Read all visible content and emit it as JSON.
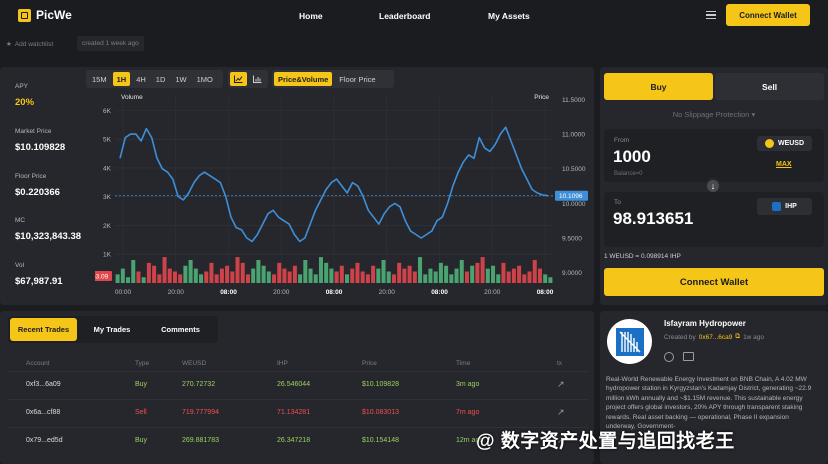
{
  "app": {
    "name": "PicWe"
  },
  "nav": {
    "links": [
      "Home",
      "Leaderboard",
      "My Assets"
    ],
    "connect_label": "Connect Wallet"
  },
  "subbar": {
    "watchlist": "Add watchlist",
    "created": "created 1 week ago"
  },
  "stats": [
    {
      "label": "APY",
      "value": "20%"
    },
    {
      "label": "Market Price",
      "value": "$10.109828"
    },
    {
      "label": "Floor Price",
      "value": "$0.220366"
    },
    {
      "label": "MC",
      "value": "$10,323,843.38"
    },
    {
      "label": "Vol",
      "value": "$67,987.91"
    }
  ],
  "chart_toolbar": {
    "intervals": [
      "15M",
      "1H",
      "4H",
      "1D",
      "1W",
      "1MO"
    ],
    "active_interval": "1H",
    "modes": [
      "Price&Volume",
      "Floor Price"
    ],
    "active_mode": "Price&Volume"
  },
  "chart_data": {
    "type": "line",
    "title": "",
    "left_axis_label": "Volume",
    "right_axis_label": "Price",
    "volume_ticks": [
      "6K",
      "5K",
      "4K",
      "3K",
      "2K",
      "1K"
    ],
    "price_ticks": [
      "11.5000",
      "11.0000",
      "10.5000",
      "10.0000",
      "9.5000",
      "9.0000"
    ],
    "x_ticks": [
      "00:00",
      "20:00",
      "08:00",
      "20:00",
      "08:00",
      "20:00",
      "08:00",
      "20:00",
      "08:00"
    ],
    "current_price_label": "10.1096",
    "current_volume_label": "53.09",
    "price": [
      10.65,
      10.95,
      11.0,
      11.0,
      10.9,
      11.08,
      10.95,
      10.65,
      10.5,
      10.45,
      10.35,
      10.1,
      10.05,
      10.15,
      10.3,
      10.4,
      10.45,
      10.4,
      10.35,
      10.3,
      10.1,
      9.8,
      9.65,
      9.62,
      9.5,
      9.45,
      9.55,
      9.7,
      9.85,
      9.9,
      9.8,
      9.75,
      9.7,
      9.55,
      9.45,
      9.5,
      9.7,
      9.9,
      10.05,
      10.2,
      10.3,
      10.35,
      10.25,
      10.15,
      10.3,
      10.25,
      10.1,
      9.9,
      9.8,
      9.7,
      9.85,
      9.95,
      10.0,
      9.95,
      9.75,
      9.6,
      9.55,
      9.5,
      9.55,
      9.6,
      9.75,
      9.8,
      10.0,
      10.25,
      10.45,
      10.6,
      10.7,
      10.65,
      10.95,
      10.8,
      10.75,
      10.85,
      11.0,
      11.1,
      10.9,
      10.7,
      10.5,
      10.35,
      10.2,
      10.15,
      10.12,
      10.11
    ],
    "volume": [
      300,
      500,
      200,
      800,
      400,
      200,
      700,
      600,
      300,
      900,
      500,
      400,
      300,
      600,
      800,
      500,
      300,
      400,
      700,
      300,
      500,
      600,
      400,
      900,
      700,
      300,
      500,
      800,
      600,
      400,
      300,
      700,
      500,
      400,
      600,
      300,
      800,
      500,
      300,
      900,
      700,
      500,
      400,
      600,
      300,
      500,
      700,
      400,
      300,
      600,
      500,
      800,
      400,
      300,
      700,
      500,
      600,
      400,
      900,
      300,
      500,
      400,
      700,
      600,
      300,
      500,
      800,
      400,
      600,
      700,
      900,
      500,
      600,
      300,
      700,
      400,
      500,
      600,
      300,
      400,
      800,
      500,
      300,
      200
    ],
    "ylim_price": [
      8.85,
      11.55
    ],
    "ylim_volume": [
      0,
      6500
    ]
  },
  "swap": {
    "tabs": [
      "Buy",
      "Sell"
    ],
    "slippage": "No Slippage Protection",
    "from_label": "From",
    "from_amount": "1000",
    "from_token": "WEUSD",
    "max_label": "MAX",
    "balance": "Balance=0",
    "to_label": "To",
    "to_amount": "98.913651",
    "to_token": "IHP",
    "rate": "1 WEUSD = 0.098914 IHP",
    "connect_label": "Connect Wallet"
  },
  "trades": {
    "tabs": [
      "Recent Trades",
      "My Trades",
      "Comments"
    ],
    "columns": [
      "Account",
      "Type",
      "WEUSD",
      "IHP",
      "Price",
      "Time",
      "tx"
    ],
    "rows": [
      {
        "account": "0xf3...6a09",
        "type": "Buy",
        "weusd": "270.72732",
        "ihp": "26.546044",
        "price": "$10.109828",
        "time": "3m ago"
      },
      {
        "account": "0x6a...cf88",
        "type": "Sell",
        "weusd": "719.777994",
        "ihp": "71.134281",
        "price": "$10.083013",
        "time": "7m ago"
      },
      {
        "account": "0x79...ed5d",
        "type": "Buy",
        "weusd": "269.881783",
        "ihp": "26.347218",
        "price": "$10.154148",
        "time": "12m ago"
      }
    ]
  },
  "project": {
    "name": "Isfayram Hydropower",
    "created_by_label": "Created by",
    "creator": "0x67...6ca9",
    "created_ago": "1w ago",
    "description": "Real-World Renewable Energy Investment on BNB Chain, A 4.02 MW hydropower station in Kyrgyzstan's Kadamjay District, generating ~22.9 million kWh annually and ~$1.15M revenue. This sustainable energy project offers global investors, 20% APY through transparent staking rewards. Real asset backing — operational, Phase II expansion underway, Government-"
  },
  "watermark": "@ 数字资产处置与追回找老王",
  "colors": {
    "accent": "#f5c518",
    "buy": "#9ad35f",
    "sell": "#f24e4e",
    "line": "#3d8fd9"
  }
}
